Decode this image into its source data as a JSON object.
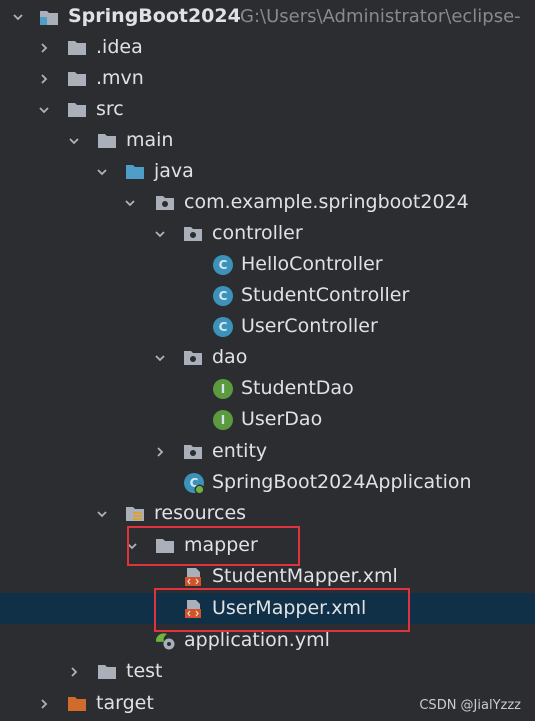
{
  "tree": {
    "root_label": "SpringBoot2024",
    "root_path": "G:\\Users\\Administrator\\eclipse-",
    "items": [
      {
        "label": ".idea"
      },
      {
        "label": ".mvn"
      },
      {
        "label": "src"
      },
      {
        "label": "main"
      },
      {
        "label": "java"
      },
      {
        "label": "com.example.springboot2024"
      },
      {
        "label": "controller"
      },
      {
        "label": "HelloController"
      },
      {
        "label": "StudentController"
      },
      {
        "label": "UserController"
      },
      {
        "label": "dao"
      },
      {
        "label": "StudentDao"
      },
      {
        "label": "UserDao"
      },
      {
        "label": "entity"
      },
      {
        "label": "SpringBoot2024Application"
      },
      {
        "label": "resources"
      },
      {
        "label": "mapper"
      },
      {
        "label": "StudentMapper.xml"
      },
      {
        "label": "UserMapper.xml"
      },
      {
        "label": "application.yml"
      },
      {
        "label": "test"
      },
      {
        "label": "target"
      }
    ],
    "class_icon_letter": "C",
    "interface_icon_letter": "I"
  },
  "watermark": "CSDN @JialYzzz",
  "colors": {
    "background": "#2b2d30",
    "selection": "#0f3046",
    "highlight_box": "#e0333d",
    "folder": "#a9b0ba",
    "source_folder": "#4e9ec7",
    "target_folder": "#d16b2b",
    "class_icon": "#3b93bb",
    "interface_icon": "#5b9a3e"
  }
}
